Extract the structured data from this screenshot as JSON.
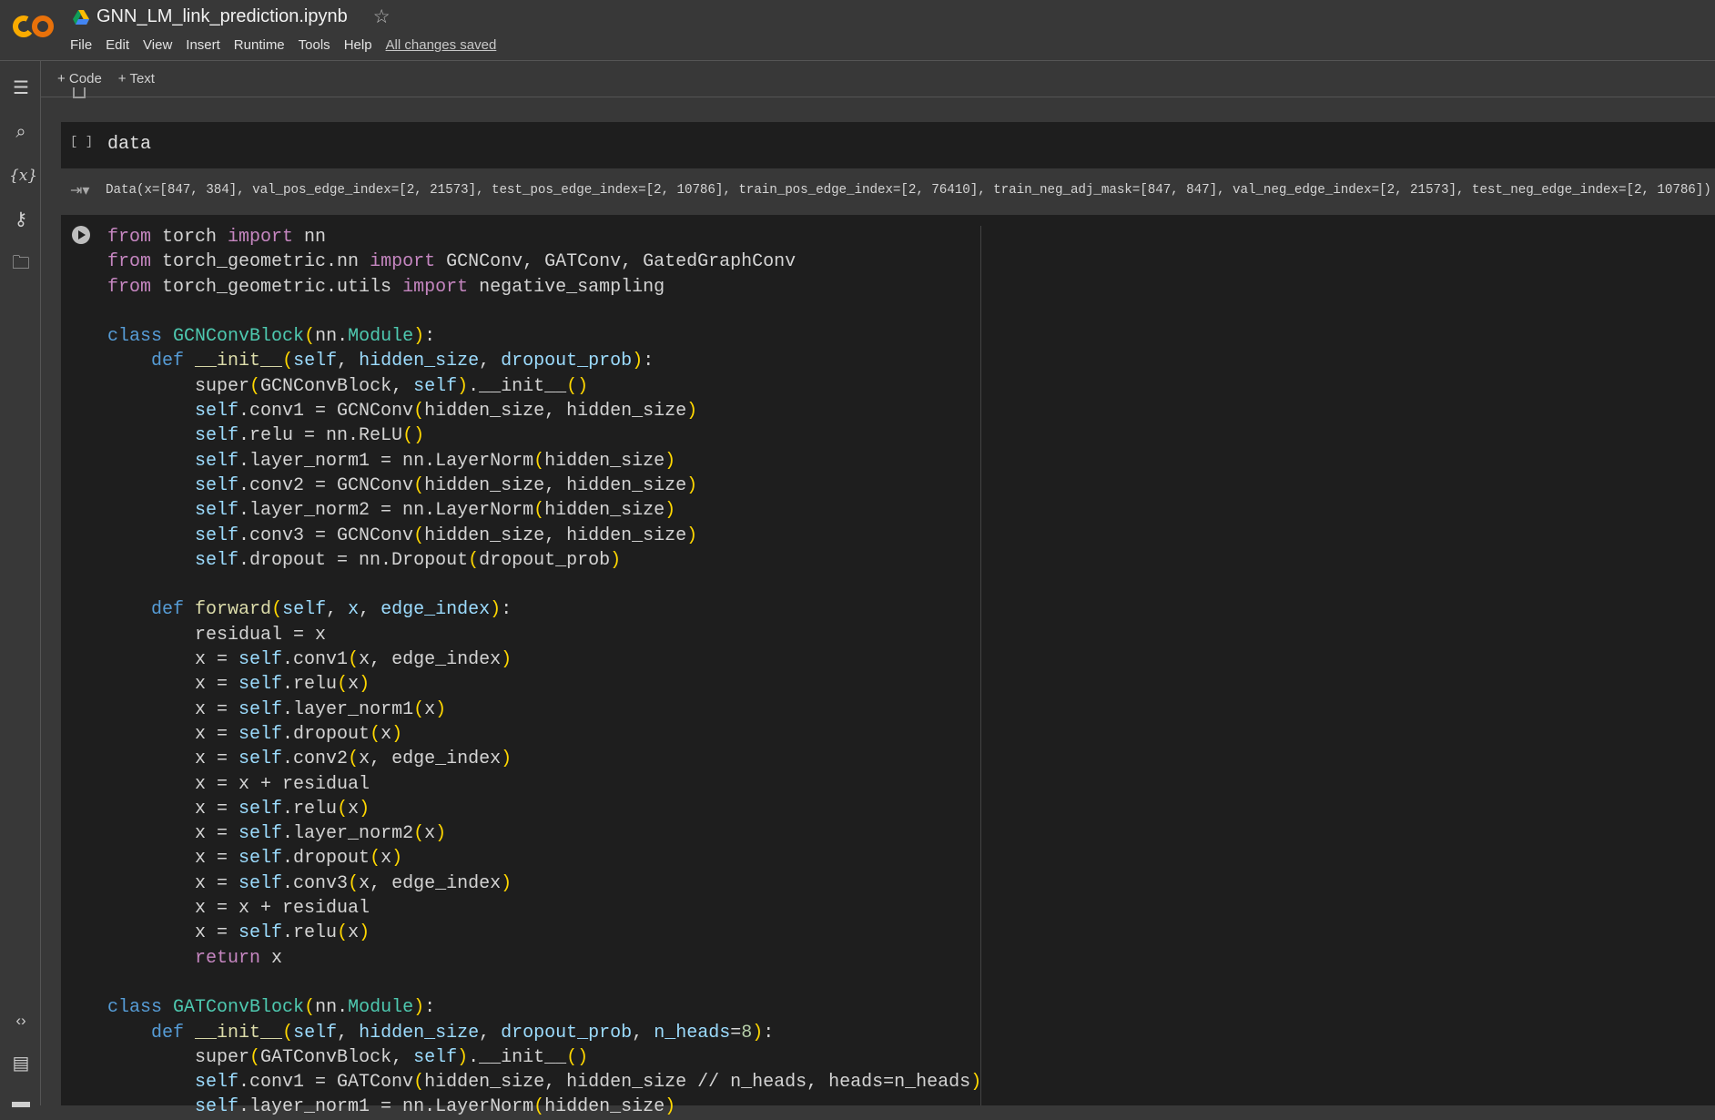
{
  "header": {
    "title": "GNN_LM_link_prediction.ipynb",
    "saved_status": "All changes saved",
    "menu": [
      "File",
      "Edit",
      "View",
      "Insert",
      "Runtime",
      "Tools",
      "Help"
    ]
  },
  "toolbar": {
    "add_code": "+ Code",
    "add_text": "+ Text"
  },
  "sidebar": {
    "icons": [
      "table-of-contents-icon",
      "search-icon",
      "variables-icon",
      "secrets-key-icon",
      "files-folder-icon",
      "code-snippets-icon",
      "command-palette-icon",
      "terminal-icon"
    ]
  },
  "cells": [
    {
      "type": "code",
      "exec": "[ ]",
      "source": "data",
      "output": "Data(x=[847, 384], val_pos_edge_index=[2, 21573], test_pos_edge_index=[2, 10786], train_pos_edge_index=[2, 76410], train_neg_adj_mask=[847, 847], val_neg_edge_index=[2, 21573], test_neg_edge_index=[2, 10786])"
    },
    {
      "type": "code",
      "lines": [
        "from torch import nn",
        "from torch_geometric.nn import GCNConv, GATConv, GatedGraphConv",
        "from torch_geometric.utils import negative_sampling",
        "",
        "class GCNConvBlock(nn.Module):",
        "    def __init__(self, hidden_size, dropout_prob):",
        "        super(GCNConvBlock, self).__init__()",
        "        self.conv1 = GCNConv(hidden_size, hidden_size)",
        "        self.relu = nn.ReLU()",
        "        self.layer_norm1 = nn.LayerNorm(hidden_size)",
        "        self.conv2 = GCNConv(hidden_size, hidden_size)",
        "        self.layer_norm2 = nn.LayerNorm(hidden_size)",
        "        self.conv3 = GCNConv(hidden_size, hidden_size)",
        "        self.dropout = nn.Dropout(dropout_prob)",
        "",
        "    def forward(self, x, edge_index):",
        "        residual = x",
        "        x = self.conv1(x, edge_index)",
        "        x = self.relu(x)",
        "        x = self.layer_norm1(x)",
        "        x = self.dropout(x)",
        "        x = self.conv2(x, edge_index)",
        "        x = x + residual",
        "        x = self.relu(x)",
        "        x = self.layer_norm2(x)",
        "        x = self.dropout(x)",
        "        x = self.conv3(x, edge_index)",
        "        x = x + residual",
        "        x = self.relu(x)",
        "        return x",
        "",
        "class GATConvBlock(nn.Module):",
        "    def __init__(self, hidden_size, dropout_prob, n_heads=8):",
        "        super(GATConvBlock, self).__init__()",
        "        self.conv1 = GATConv(hidden_size, hidden_size // n_heads, heads=n_heads)",
        "        self.layer_norm1 = nn.LayerNorm(hidden_size)"
      ]
    }
  ],
  "colors": {
    "keyword": "#c586c0",
    "def": "#569cd6",
    "class_name": "#4ec9b0",
    "self": "#9cdcfe",
    "paren": "#ffd700",
    "number": "#b5cea8",
    "background": "#1e1e1e"
  }
}
